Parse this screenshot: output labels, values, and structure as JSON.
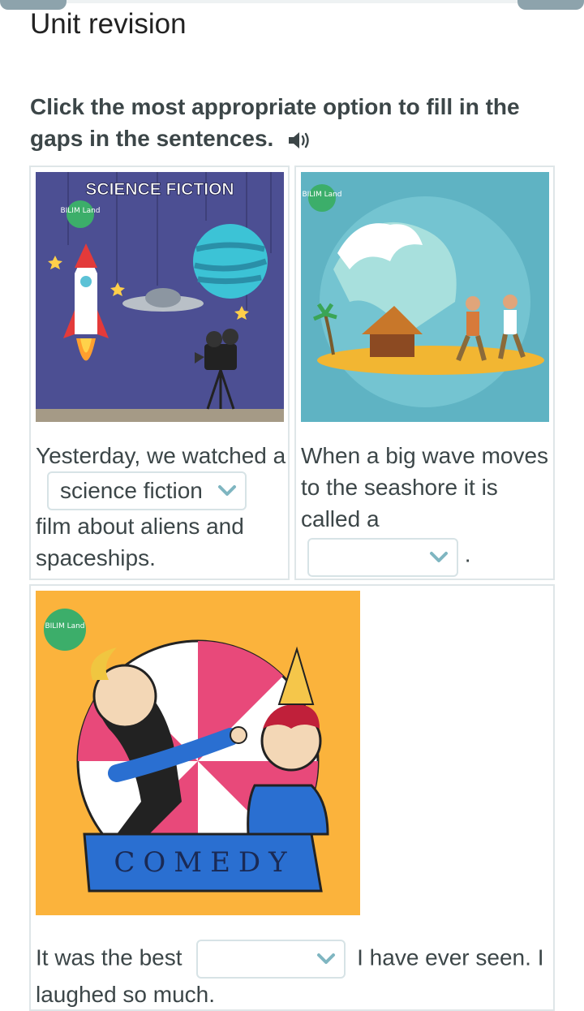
{
  "header": {
    "title": "Unit revision"
  },
  "instruction": {
    "text": "Click the most appropriate option to fill in the gaps in the sentences.",
    "audio_icon": "speaker-icon"
  },
  "cards": [
    {
      "image": {
        "caption": "SCIENCE FICTION",
        "badge": "BILIM Land"
      },
      "before": "Yesterday, we watched a",
      "selected": "science fiction",
      "after": "film about aliens and spaceships."
    },
    {
      "image": {
        "badge": "BILIM Land"
      },
      "before": "When a big wave moves to the seashore it is called a",
      "selected": "",
      "after": "."
    },
    {
      "image": {
        "caption": "COMEDY",
        "badge": "BILIM Land"
      },
      "before": "It was the best",
      "selected": "",
      "after": "I have ever seen. I laughed so much."
    }
  ],
  "colors": {
    "accent": "#7fb6c1",
    "border": "#dfe6e8",
    "text": "#3c4648"
  }
}
